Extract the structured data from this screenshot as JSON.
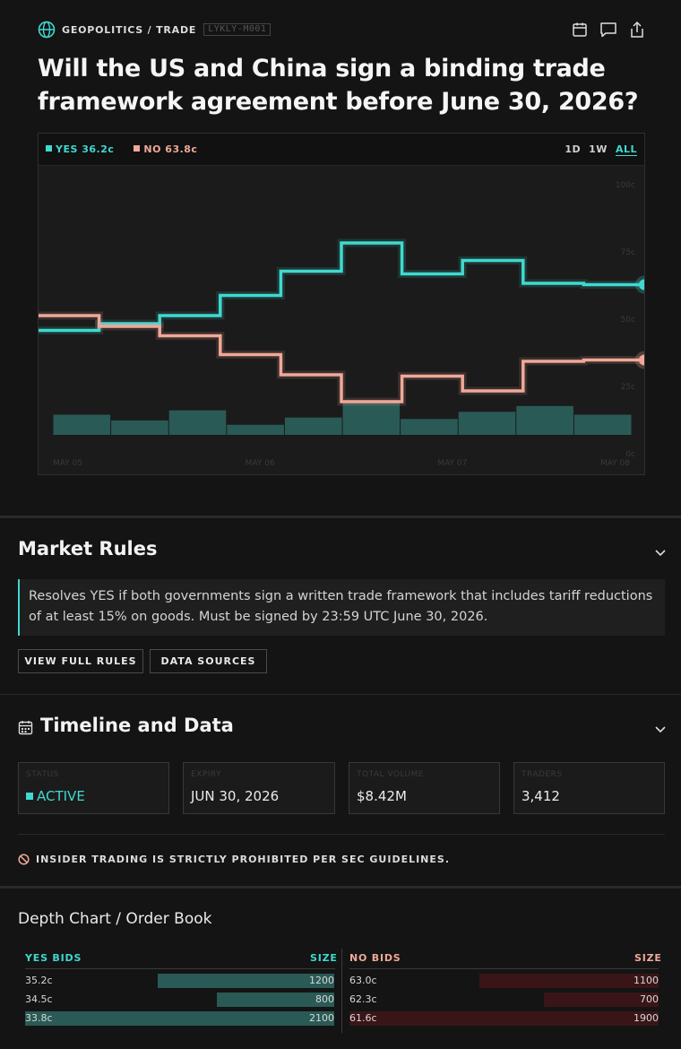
{
  "header": {
    "category": "GEOPOLITICS / TRADE",
    "market_id": "LYKLY-M001",
    "title": "Will the US and China sign a binding trade framework agreement before June 30, 2026?",
    "icons": [
      "calendar-icon",
      "comment-icon",
      "share-icon"
    ]
  },
  "legend": {
    "yes_label": "YES 36.2c",
    "no_label": "NO 63.8c"
  },
  "ranges": [
    "1D",
    "1W",
    "ALL"
  ],
  "active_range": "ALL",
  "colors": {
    "yes": "#3fd9cf",
    "no": "#f0a898",
    "volume": "#2a5a55",
    "no_bid_bar": "#3a1518",
    "background": "#141414"
  },
  "chart_data": {
    "type": "line",
    "x_labels": [
      "MAY 05",
      "MAY 06",
      "MAY 07",
      "MAY 08"
    ],
    "y_ticks": [
      "100c",
      "75c",
      "50c",
      "25c",
      "0c"
    ],
    "ylim": [
      0,
      100
    ],
    "step": true,
    "series": [
      {
        "name": "YES",
        "values": [
          45.5,
          48,
          51,
          58.5,
          67.5,
          78,
          66.5,
          71.5,
          63,
          62.5,
          62.5
        ]
      },
      {
        "name": "NO",
        "values": [
          51,
          47,
          43.5,
          36.5,
          29,
          19,
          28.5,
          23,
          34,
          34.5,
          34.5
        ]
      }
    ],
    "volume": [
      7,
      5,
      8.5,
      3.5,
      6,
      11,
      5.5,
      8,
      10,
      7
    ]
  },
  "rules": {
    "title": "Market Rules",
    "text": "Resolves YES if both governments sign a written trade framework that includes tariff reductions of at least 15% on goods. Must be signed by 23:59 UTC June 30, 2026.",
    "view_full_rules": "VIEW FULL RULES",
    "data_sources": "DATA SOURCES"
  },
  "timeline": {
    "title": "Timeline and Data",
    "stats": [
      {
        "label": "STATUS",
        "value": "ACTIVE"
      },
      {
        "label": "EXPIRY",
        "value": "JUN 30, 2026"
      },
      {
        "label": "TOTAL VOLUME",
        "value": "$8.42M"
      },
      {
        "label": "TRADERS",
        "value": "3,412"
      }
    ],
    "warning": "INSIDER TRADING IS STRICTLY PROHIBITED PER SEC GUIDELINES."
  },
  "order_book": {
    "title": "Depth Chart / Order Book",
    "yes_header": "YES BIDS",
    "no_header": "NO BIDS",
    "size_header": "SIZE",
    "yes_bids": [
      {
        "price": "35.2c",
        "size": "1200",
        "fill": 0.57
      },
      {
        "price": "34.5c",
        "size": "800",
        "fill": 0.38
      },
      {
        "price": "33.8c",
        "size": "2100",
        "fill": 1.0
      }
    ],
    "no_bids": [
      {
        "price": "63.0c",
        "size": "1100",
        "fill": 0.58
      },
      {
        "price": "62.3c",
        "size": "700",
        "fill": 0.37
      },
      {
        "price": "61.6c",
        "size": "1900",
        "fill": 1.0
      }
    ]
  }
}
